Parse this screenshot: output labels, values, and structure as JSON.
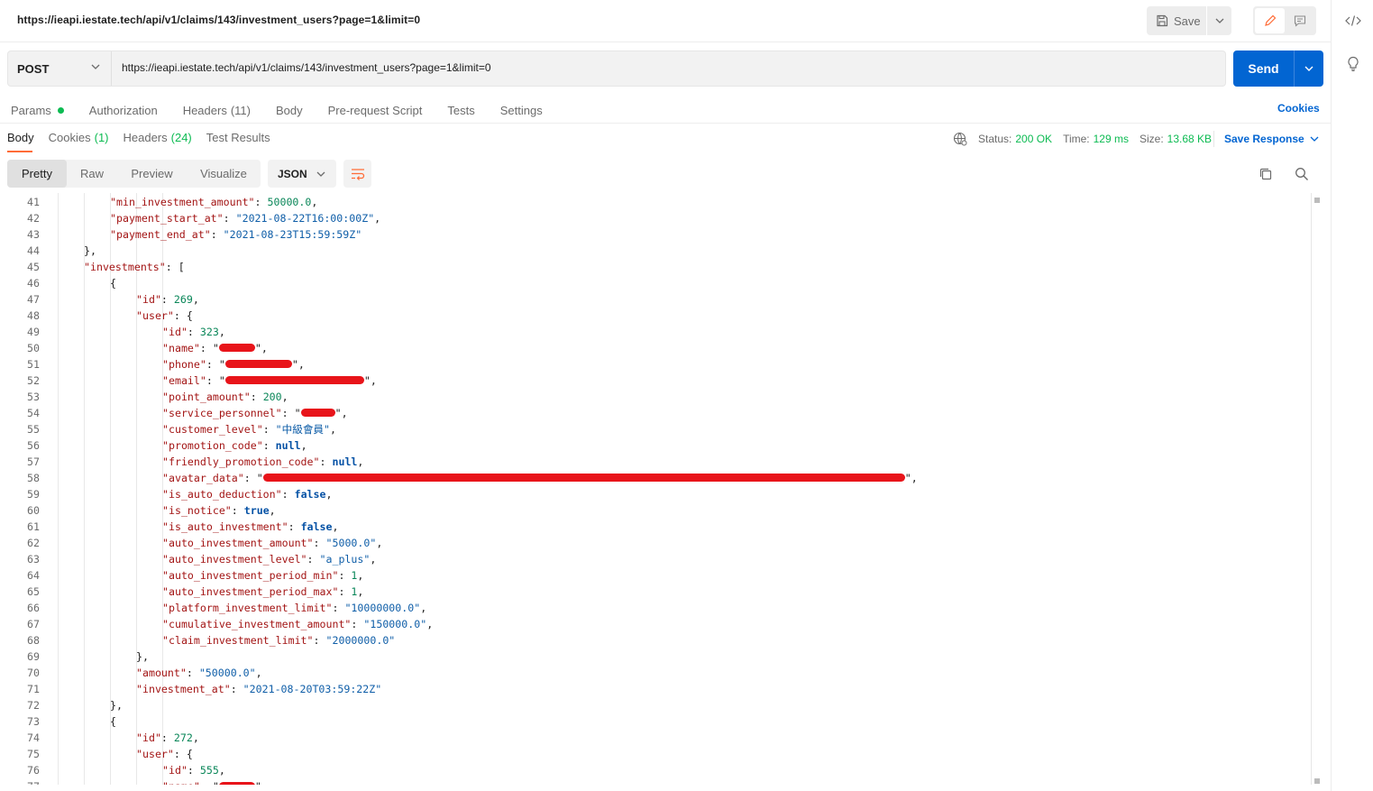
{
  "header": {
    "request_title": "https://ieapi.iestate.tech/api/v1/claims/143/investment_users?page=1&limit=0",
    "save_label": "Save"
  },
  "request": {
    "method": "POST",
    "url": "https://ieapi.iestate.tech/api/v1/claims/143/investment_users?page=1&limit=0",
    "send_label": "Send"
  },
  "request_tabs": [
    {
      "label": "Params",
      "count": ""
    },
    {
      "label": "Authorization",
      "count": ""
    },
    {
      "label": "Headers",
      "count": "(11)"
    },
    {
      "label": "Body",
      "count": ""
    },
    {
      "label": "Pre-request Script",
      "count": ""
    },
    {
      "label": "Tests",
      "count": ""
    },
    {
      "label": "Settings",
      "count": ""
    }
  ],
  "cookies_link": "Cookies",
  "response_tabs": [
    {
      "label": "Body",
      "count": ""
    },
    {
      "label": "Cookies",
      "count": "(1)"
    },
    {
      "label": "Headers",
      "count": "(24)"
    },
    {
      "label": "Test Results",
      "count": ""
    }
  ],
  "status": {
    "status_label": "Status:",
    "status_value": "200 OK",
    "time_label": "Time:",
    "time_value": "129 ms",
    "size_label": "Size:",
    "size_value": "13.68 KB"
  },
  "save_response_label": "Save Response",
  "view_modes": [
    "Pretty",
    "Raw",
    "Preview",
    "Visualize"
  ],
  "format": "JSON",
  "colors": {
    "accent": "#0265d2",
    "status_ok": "#0cbb52",
    "active_tab": "#ff6c37",
    "redaction": "#e8141a"
  },
  "code_lines": [
    {
      "n": "41",
      "indent": 3,
      "key": "min_investment_amount",
      "value": "50000.0",
      "type": "num",
      "trail": ","
    },
    {
      "n": "42",
      "indent": 3,
      "key": "payment_start_at",
      "value": "\"2021-08-22T16:00:00Z\"",
      "type": "str",
      "trail": ","
    },
    {
      "n": "43",
      "indent": 3,
      "key": "payment_end_at",
      "value": "\"2021-08-23T15:59:59Z\"",
      "type": "str",
      "trail": ""
    },
    {
      "n": "44",
      "indent": 2,
      "raw": "},"
    },
    {
      "n": "45",
      "indent": 2,
      "key": "investments",
      "value": "[",
      "type": "punct",
      "trail": ""
    },
    {
      "n": "46",
      "indent": 3,
      "raw": "{"
    },
    {
      "n": "47",
      "indent": 4,
      "key": "id",
      "value": "269",
      "type": "num",
      "trail": ","
    },
    {
      "n": "48",
      "indent": 4,
      "key": "user",
      "value": "{",
      "type": "punct",
      "trail": ""
    },
    {
      "n": "49",
      "indent": 5,
      "key": "id",
      "value": "323",
      "type": "num",
      "trail": ","
    },
    {
      "n": "50",
      "indent": 5,
      "key": "name",
      "value": "",
      "type": "redacted",
      "redact_width": 40,
      "trail": ","
    },
    {
      "n": "51",
      "indent": 5,
      "key": "phone",
      "value": "",
      "type": "redacted",
      "redact_width": 74,
      "trail": ","
    },
    {
      "n": "52",
      "indent": 5,
      "key": "email",
      "value": "",
      "type": "redacted",
      "redact_width": 154,
      "trail": ","
    },
    {
      "n": "53",
      "indent": 5,
      "key": "point_amount",
      "value": "200",
      "type": "num",
      "trail": ","
    },
    {
      "n": "54",
      "indent": 5,
      "key": "service_personnel",
      "value": "",
      "type": "redacted",
      "redact_width": 38,
      "trail": ","
    },
    {
      "n": "55",
      "indent": 5,
      "key": "customer_level",
      "value": "\"中級會員\"",
      "type": "str",
      "trail": ","
    },
    {
      "n": "56",
      "indent": 5,
      "key": "promotion_code",
      "value": "null",
      "type": "kw",
      "trail": ","
    },
    {
      "n": "57",
      "indent": 5,
      "key": "friendly_promotion_code",
      "value": "null",
      "type": "kw",
      "trail": ","
    },
    {
      "n": "58",
      "indent": 5,
      "key": "avatar_data",
      "value": "",
      "type": "redacted",
      "redact_width": 712,
      "trail": ","
    },
    {
      "n": "59",
      "indent": 5,
      "key": "is_auto_deduction",
      "value": "false",
      "type": "kw",
      "trail": ","
    },
    {
      "n": "60",
      "indent": 5,
      "key": "is_notice",
      "value": "true",
      "type": "kw",
      "trail": ","
    },
    {
      "n": "61",
      "indent": 5,
      "key": "is_auto_investment",
      "value": "false",
      "type": "kw",
      "trail": ","
    },
    {
      "n": "62",
      "indent": 5,
      "key": "auto_investment_amount",
      "value": "\"5000.0\"",
      "type": "str",
      "trail": ","
    },
    {
      "n": "63",
      "indent": 5,
      "key": "auto_investment_level",
      "value": "\"a_plus\"",
      "type": "str",
      "trail": ","
    },
    {
      "n": "64",
      "indent": 5,
      "key": "auto_investment_period_min",
      "value": "1",
      "type": "num",
      "trail": ","
    },
    {
      "n": "65",
      "indent": 5,
      "key": "auto_investment_period_max",
      "value": "1",
      "type": "num",
      "trail": ","
    },
    {
      "n": "66",
      "indent": 5,
      "key": "platform_investment_limit",
      "value": "\"10000000.0\"",
      "type": "str",
      "trail": ","
    },
    {
      "n": "67",
      "indent": 5,
      "key": "cumulative_investment_amount",
      "value": "\"150000.0\"",
      "type": "str",
      "trail": ","
    },
    {
      "n": "68",
      "indent": 5,
      "key": "claim_investment_limit",
      "value": "\"2000000.0\"",
      "type": "str",
      "trail": ""
    },
    {
      "n": "69",
      "indent": 4,
      "raw": "},"
    },
    {
      "n": "70",
      "indent": 4,
      "key": "amount",
      "value": "\"50000.0\"",
      "type": "str",
      "trail": ","
    },
    {
      "n": "71",
      "indent": 4,
      "key": "investment_at",
      "value": "\"2021-08-20T03:59:22Z\"",
      "type": "str",
      "trail": ""
    },
    {
      "n": "72",
      "indent": 3,
      "raw": "},"
    },
    {
      "n": "73",
      "indent": 3,
      "raw": "{"
    },
    {
      "n": "74",
      "indent": 4,
      "key": "id",
      "value": "272",
      "type": "num",
      "trail": ","
    },
    {
      "n": "75",
      "indent": 4,
      "key": "user",
      "value": "{",
      "type": "punct",
      "trail": ""
    },
    {
      "n": "76",
      "indent": 5,
      "key": "id",
      "value": "555",
      "type": "num",
      "trail": ","
    },
    {
      "n": "77",
      "indent": 5,
      "key": "name",
      "value": "",
      "type": "redacted",
      "redact_width": 40,
      "trail": ","
    }
  ]
}
